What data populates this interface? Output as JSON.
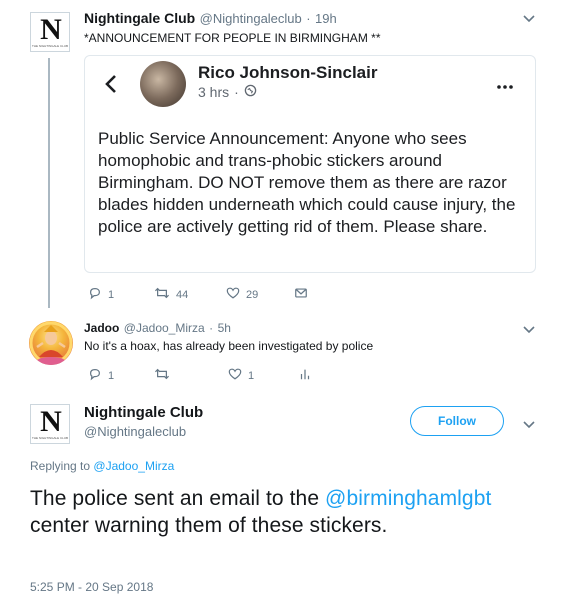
{
  "tweet1": {
    "name": "Nightingale Club",
    "handle": "@Nightingaleclub",
    "time": "19h",
    "text": "*ANNOUNCEMENT FOR PEOPLE IN BIRMINGHAM **",
    "actions": {
      "replies": "1",
      "retweets": "44",
      "likes": "29"
    }
  },
  "card": {
    "author": "Rico Johnson-Sinclair",
    "meta": "3 hrs",
    "body": "Public Service Announcement: Anyone who sees homophobic and trans-phobic stickers around Birmingham. DO NOT remove them as there are razor blades hidden underneath which could cause injury, the police are actively getting rid of them. Please share."
  },
  "tweet2": {
    "name": "Jadoo",
    "handle": "@Jadoo_Mirza",
    "time": "5h",
    "text": "No it's a hoax, has already been investigated by police",
    "actions": {
      "replies": "1",
      "retweets": "",
      "likes": "1"
    }
  },
  "tweet3": {
    "name": "Nightingale Club",
    "handle": "@Nightingaleclub",
    "follow_label": "Follow",
    "replying_prefix": "Replying to",
    "replying_to": "@Jadoo_Mirza",
    "text_before": "The police sent an email to the ",
    "mention": "@birminghamlgbt",
    "text_after": " center warning them of these stickers.",
    "timestamp": "5:25 PM - 20 Sep 2018"
  },
  "logo": {
    "mark": "N",
    "tiny": "THE NIGHTINGALE CLUB"
  },
  "colors": {
    "accent": "#1da1f2",
    "muted": "#657786",
    "border": "#e1e8ed"
  },
  "icons": [
    "reply-icon",
    "retweet-icon",
    "like-icon",
    "dm-icon",
    "analytics-icon",
    "chevron-down-icon",
    "back-arrow-icon",
    "more-icon",
    "globe-icon"
  ]
}
